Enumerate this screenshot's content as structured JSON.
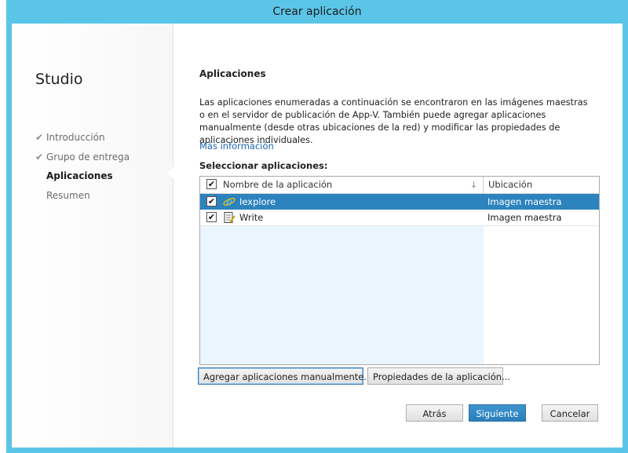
{
  "window": {
    "title": "Crear aplicación"
  },
  "sidebar": {
    "app_name": "Studio",
    "steps": [
      {
        "label": "Introducción",
        "done": true,
        "active": false
      },
      {
        "label": "Grupo de entrega",
        "done": true,
        "active": false
      },
      {
        "label": "Aplicaciones",
        "done": false,
        "active": true
      },
      {
        "label": "Resumen",
        "done": false,
        "active": false
      }
    ],
    "check_glyph": "✔"
  },
  "main": {
    "heading": "Aplicaciones",
    "description": "Las aplicaciones enumeradas a continuación se encontraron en las imágenes maestras o en el servidor de publicación de App-V. También puede agregar aplicaciones manualmente (desde otras ubicaciones de la red) y modificar las propiedades de aplicaciones individuales.",
    "more_info_link": "Más información",
    "select_label": "Seleccionar aplicaciones:",
    "table": {
      "col_name": "Nombre de la aplicación",
      "col_location": "Ubicación",
      "sort_glyph": "↓",
      "rows": [
        {
          "name": "Iexplore",
          "location": "Imagen maestra",
          "checked": true,
          "selected": true,
          "icon": "internet-explorer-icon"
        },
        {
          "name": "Write",
          "location": "Imagen maestra",
          "checked": true,
          "selected": false,
          "icon": "wordpad-icon"
        }
      ]
    },
    "add_manual_button": "Agregar aplicaciones manualmente...",
    "properties_button": "Propiedades de la aplicación..."
  },
  "footer": {
    "back_button": "Atrás",
    "next_button": "Siguiente",
    "cancel_button": "Cancelar"
  },
  "colors": {
    "frame": "#5bc5e8",
    "selection": "#2c83be",
    "link": "#1a66b5"
  }
}
